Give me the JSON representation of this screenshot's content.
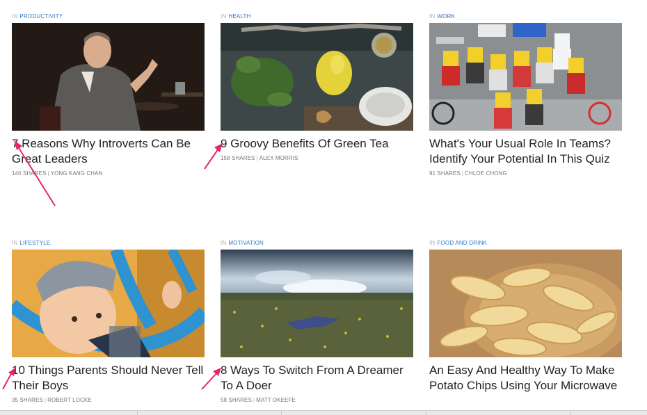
{
  "in_label": "IN",
  "articles": [
    {
      "category": "PRODUCTIVITY",
      "title": "7 Reasons Why Introverts Can Be Great Leaders",
      "shares": "140 SHARES",
      "author": "YONG KANG CHAN",
      "image": "man-speaking-photo"
    },
    {
      "category": "HEALTH",
      "title": "9 Groovy Benefits Of Green Tea",
      "shares": "158 SHARES",
      "author": "ALEX MORRIS",
      "image": "tea-lemon-photo"
    },
    {
      "category": "WORK",
      "title": "What's Your Usual Role In Teams? Identify Your Potential In This Quiz",
      "shares": "91 SHARES",
      "author": "CHLOE CHONG",
      "image": "lego-figures-photo"
    },
    {
      "category": "LIFESTYLE",
      "title": "10 Things Parents Should Never Tell Their Boys",
      "shares": "35 SHARES",
      "author": "ROBERT LOCKE",
      "image": "child-playground-photo"
    },
    {
      "category": "MOTIVATION",
      "title": "8 Ways To Switch From A Dreamer To A Doer",
      "shares": "58 SHARES",
      "author": "MATT OKEEFE",
      "image": "person-in-field-photo"
    },
    {
      "category": "FOOD AND DRINK",
      "title": "An Easy And Healthy Way To Make Potato Chips Using Your Microwave",
      "shares": "",
      "author": "",
      "image": "potato-chips-photo"
    }
  ],
  "colors": {
    "category": "#2f78c7",
    "arrow": "#e8246a",
    "title": "#222222"
  }
}
